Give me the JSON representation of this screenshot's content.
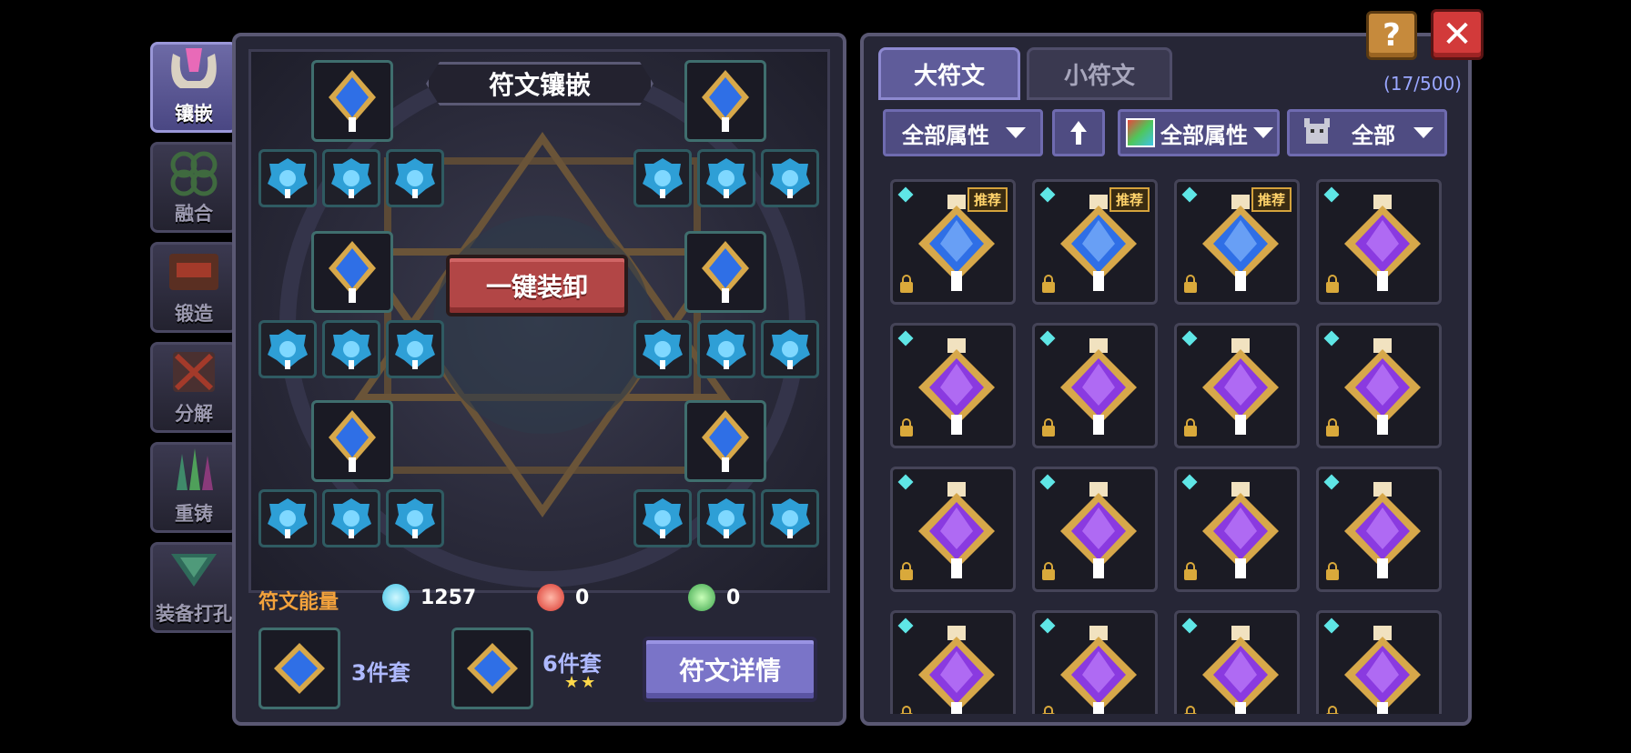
{
  "side_tabs": [
    {
      "label": "镶嵌",
      "icon": "inlay-icon",
      "active": true
    },
    {
      "label": "融合",
      "icon": "fuse-icon",
      "active": false
    },
    {
      "label": "锻造",
      "icon": "forge-icon",
      "active": false
    },
    {
      "label": "分解",
      "icon": "dismantle-icon",
      "active": false
    },
    {
      "label": "重铸",
      "icon": "recast-icon",
      "active": false
    },
    {
      "label": "装备打孔",
      "icon": "socket-icon",
      "active": false
    }
  ],
  "left_panel": {
    "title": "符文镶嵌",
    "unequip_all_label": "一键装卸",
    "energy": {
      "label": "符文能量",
      "items": [
        {
          "icon": "blue-crystal-icon",
          "value": "1257",
          "color": "#6fe3ff"
        },
        {
          "icon": "red-flame-icon",
          "value": "0",
          "color": "#e8463d"
        },
        {
          "icon": "green-leaf-icon",
          "value": "0",
          "color": "#4fc65a"
        }
      ]
    },
    "sets": [
      {
        "label": "3件套"
      },
      {
        "label": "6件套",
        "stars": "★★"
      }
    ],
    "detail_button": "符文详情"
  },
  "right_panel": {
    "tabs": [
      {
        "label": "大符文",
        "active": true
      },
      {
        "label": "小符文",
        "active": false
      }
    ],
    "count": "(17/500)",
    "filters": {
      "attribute": "全部属性",
      "sort_icon": "arrow-up-icon",
      "color_attribute": "全部属性",
      "type": "全部"
    },
    "badge_label": "推荐",
    "items": [
      {
        "color": "blue",
        "recommended": true
      },
      {
        "color": "blue",
        "recommended": true
      },
      {
        "color": "blue",
        "recommended": true
      },
      {
        "color": "purple",
        "recommended": false
      },
      {
        "color": "purple",
        "recommended": false
      },
      {
        "color": "purple",
        "recommended": false
      },
      {
        "color": "purple",
        "recommended": false
      },
      {
        "color": "purple",
        "recommended": false
      },
      {
        "color": "purple",
        "recommended": false
      },
      {
        "color": "purple",
        "recommended": false
      },
      {
        "color": "purple",
        "recommended": false
      },
      {
        "color": "purple",
        "recommended": false
      },
      {
        "color": "purple",
        "recommended": false
      },
      {
        "color": "purple",
        "recommended": false
      },
      {
        "color": "purple",
        "recommended": false
      },
      {
        "color": "purple",
        "recommended": false
      }
    ]
  },
  "corner": {
    "help_label": "?",
    "close_label": "✕"
  }
}
